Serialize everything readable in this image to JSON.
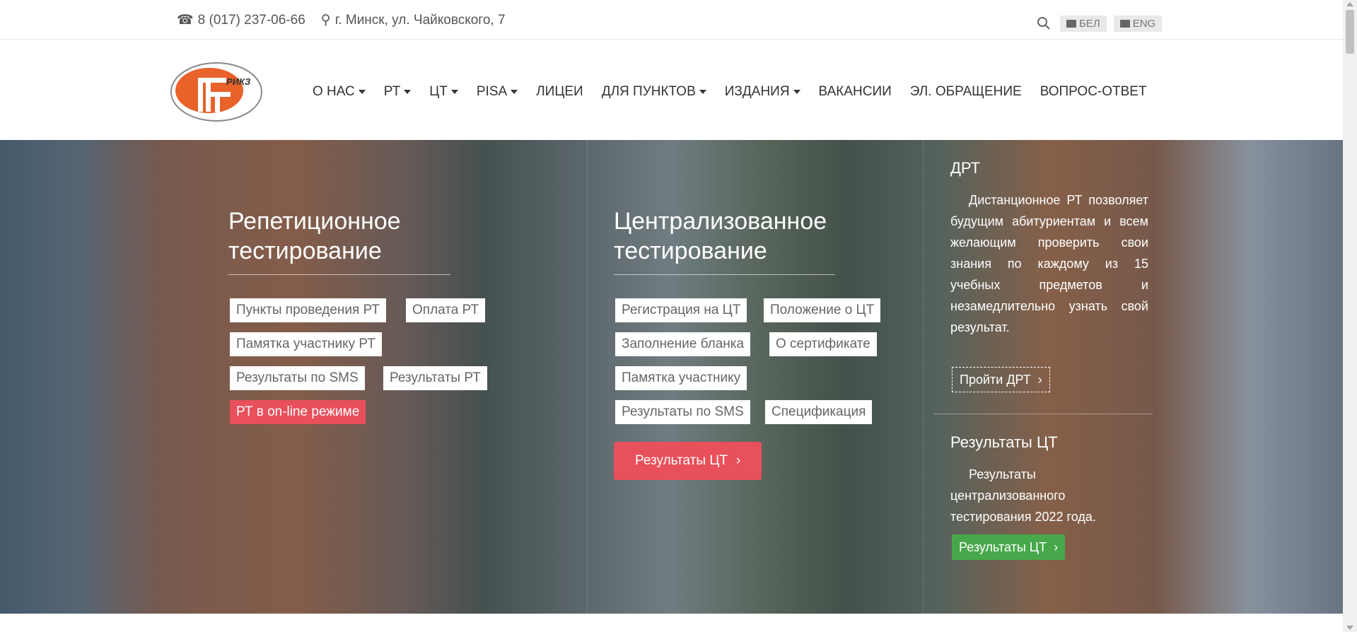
{
  "topbar": {
    "phone": "8 (017) 237-06-66",
    "address": "г. Минск, ул. Чайковского, 7",
    "search_icon": "search-icon",
    "lang_bel": "БЕЛ",
    "lang_eng": "ENG"
  },
  "logo": {
    "text": "РИКЗ"
  },
  "nav": {
    "items": [
      {
        "label": "О НАС",
        "dropdown": true
      },
      {
        "label": "РТ",
        "dropdown": true
      },
      {
        "label": "ЦТ",
        "dropdown": true
      },
      {
        "label": "PISA",
        "dropdown": true
      },
      {
        "label": "ЛИЦЕИ",
        "dropdown": false
      },
      {
        "label": "ДЛЯ ПУНКТОВ",
        "dropdown": true
      },
      {
        "label": "ИЗДАНИЯ",
        "dropdown": true
      },
      {
        "label": "ВАКАНСИИ",
        "dropdown": false
      },
      {
        "label": "ЭЛ. ОБРАЩЕНИЕ",
        "dropdown": false
      },
      {
        "label": "ВОПРОС-ОТВЕТ",
        "dropdown": false
      }
    ]
  },
  "rt": {
    "title_line1": "Репетиционное",
    "title_line2": "тестирование",
    "links": [
      "Пункты проведения РТ",
      "Оплата РТ",
      "Памятка участнику РТ",
      "Результаты по SMS",
      "Результаты РТ",
      "РТ в on-line режиме"
    ]
  },
  "ct": {
    "title_line1": "Централизованное",
    "title_line2": "тестирование",
    "links": [
      "Регистрация на ЦТ",
      "Положение о ЦТ",
      "Заполнение бланка",
      "О сертификате",
      "Памятка участнику",
      "Результаты по SMS",
      "Спецификация"
    ],
    "button": "Результаты ЦТ"
  },
  "drt": {
    "title": "ДРТ",
    "text": "Дистанционное РТ позволяет будущим абитуриентам и всем желающим проверить свои знания по каждому из 15 учебных предметов и незамедлительно узнать свой результат.",
    "button": "Пройти ДРТ"
  },
  "results": {
    "title": "Результаты ЦТ",
    "text_line1": "Результаты",
    "text_line2": "централизованного",
    "text_line3": "тестирования 2022 года.",
    "button": "Результаты ЦТ"
  },
  "colors": {
    "accent_red": "#e8505b",
    "green": "#46a84a",
    "logo_orange": "#e8622a"
  }
}
